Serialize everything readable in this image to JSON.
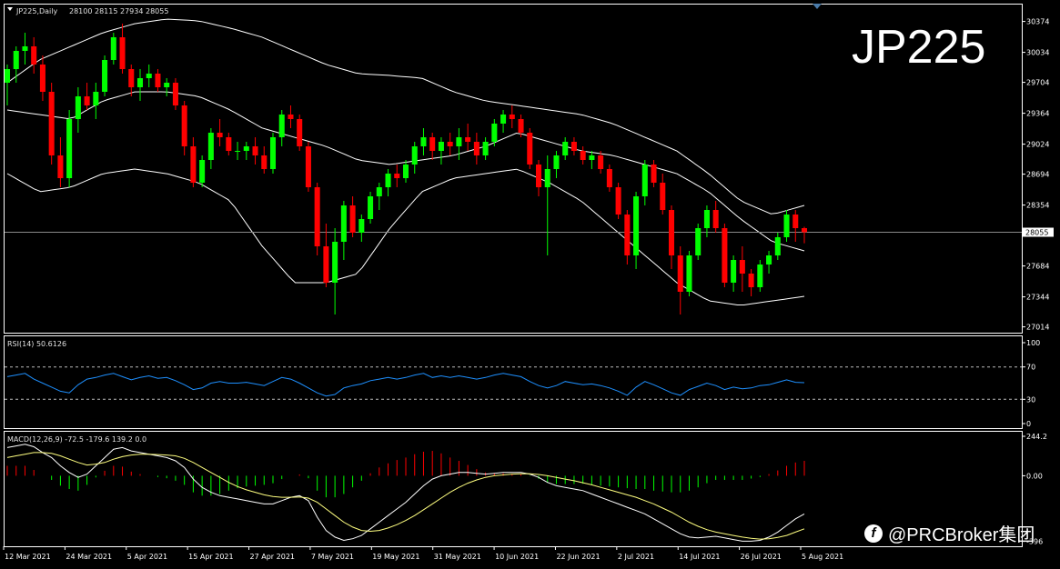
{
  "symbol_label": "JP225,Daily",
  "ohlc_label": "28100 28115 27934 28055",
  "watermark": "JP225",
  "brand": "@PRCBroker集团",
  "rsi_label": "RSI(14) 50.6126",
  "macd_label": "MACD(12,26,9) -72.5 -179.6 139.2 0.0",
  "colors": {
    "bull": "#00ff00",
    "bear": "#ff0000",
    "bands": "#ffffff",
    "rsi": "#1e90ff",
    "macd_signal": "#ffff80",
    "frame": "#ffffff",
    "price_line": "#8a8a8a"
  },
  "chart_data": [
    {
      "type": "candlestick",
      "title": "JP225,Daily",
      "y_ticks": [
        30374,
        30034,
        29704,
        29364,
        29024,
        28694,
        28354,
        28055,
        27684,
        27344,
        27014
      ],
      "ylim": [
        26950,
        30560
      ],
      "x_ticks": [
        "12 Mar 2021",
        "24 Mar 2021",
        "5 Apr 2021",
        "15 Apr 2021",
        "27 Apr 2021",
        "7 May 2021",
        "19 May 2021",
        "31 May 2021",
        "10 Jun 2021",
        "22 Jun 2021",
        "2 Jul 2021",
        "14 Jul 2021",
        "26 Jul 2021",
        "5 Aug 2021"
      ],
      "current_price": 28055,
      "bollinger": {
        "upper": [
          29700,
          29950,
          30100,
          30250,
          30350,
          30400,
          30380,
          30300,
          30200,
          30050,
          29900,
          29800,
          29780,
          29750,
          29600,
          29500,
          29450,
          29400,
          29350,
          29250,
          29100,
          28950,
          28700,
          28400,
          28250,
          28350
        ],
        "middle": [
          29400,
          29350,
          29300,
          29500,
          29600,
          29600,
          29550,
          29400,
          29200,
          29100,
          29000,
          28850,
          28800,
          28850,
          28900,
          29000,
          29150,
          29050,
          28950,
          28900,
          28800,
          28700,
          28500,
          28200,
          27950,
          27850
        ],
        "lower": [
          28700,
          28500,
          28550,
          28700,
          28750,
          28700,
          28600,
          28400,
          27900,
          27500,
          27500,
          27600,
          28100,
          28500,
          28650,
          28700,
          28750,
          28600,
          28400,
          28100,
          27800,
          27500,
          27300,
          27250,
          27300,
          27350
        ]
      },
      "series": [
        {
          "ohlc": [
            [
              29700,
              29900,
              29450,
              29850
            ],
            [
              29850,
              30100,
              29700,
              30050
            ],
            [
              30050,
              30250,
              29900,
              30100
            ],
            [
              30100,
              30200,
              29800,
              29900
            ],
            [
              29900,
              30000,
              29500,
              29600
            ],
            [
              29600,
              29700,
              28800,
              28900
            ],
            [
              28900,
              29100,
              28550,
              28650
            ],
            [
              28650,
              29400,
              28550,
              29300
            ],
            [
              29300,
              29650,
              29150,
              29550
            ],
            [
              29550,
              29700,
              29400,
              29450
            ],
            [
              29450,
              29700,
              29300,
              29600
            ],
            [
              29600,
              30000,
              29550,
              29950
            ],
            [
              29950,
              30250,
              29900,
              30200
            ],
            [
              30200,
              30350,
              29800,
              29850
            ],
            [
              29850,
              29900,
              29550,
              29650
            ],
            [
              29650,
              29850,
              29500,
              29750
            ],
            [
              29750,
              29900,
              29650,
              29800
            ],
            [
              29800,
              29850,
              29600,
              29650
            ],
            [
              29650,
              29750,
              29550,
              29700
            ],
            [
              29700,
              29750,
              29400,
              29450
            ],
            [
              29450,
              29500,
              28900,
              29000
            ],
            [
              29000,
              29100,
              28550,
              28600
            ],
            [
              28600,
              28900,
              28550,
              28850
            ],
            [
              28850,
              29200,
              28750,
              29150
            ],
            [
              29150,
              29300,
              29000,
              29100
            ],
            [
              29100,
              29150,
              28900,
              28950
            ],
            [
              28950,
              29050,
              28850,
              28950
            ],
            [
              28950,
              29050,
              28850,
              29000
            ],
            [
              29000,
              29100,
              28800,
              28900
            ],
            [
              28900,
              29000,
              28700,
              28750
            ],
            [
              28750,
              29150,
              28700,
              29100
            ],
            [
              29100,
              29400,
              29000,
              29350
            ],
            [
              29350,
              29450,
              29200,
              29300
            ],
            [
              29300,
              29350,
              28950,
              29000
            ],
            [
              29000,
              29050,
              28500,
              28550
            ],
            [
              28550,
              28600,
              27800,
              27900
            ],
            [
              27900,
              28150,
              27450,
              27500
            ],
            [
              27500,
              28100,
              27150,
              27950
            ],
            [
              27950,
              28400,
              27750,
              28350
            ],
            [
              28350,
              28450,
              28000,
              28050
            ],
            [
              28050,
              28250,
              27950,
              28200
            ],
            [
              28200,
              28500,
              28150,
              28450
            ],
            [
              28450,
              28600,
              28300,
              28550
            ],
            [
              28550,
              28750,
              28450,
              28700
            ],
            [
              28700,
              28800,
              28550,
              28650
            ],
            [
              28650,
              28850,
              28600,
              28800
            ],
            [
              28800,
              29050,
              28700,
              29000
            ],
            [
              29000,
              29200,
              28900,
              29100
            ],
            [
              29100,
              29150,
              28850,
              28950
            ],
            [
              28950,
              29100,
              28800,
              29050
            ],
            [
              29050,
              29150,
              28900,
              29000
            ],
            [
              29000,
              29200,
              28850,
              29100
            ],
            [
              29100,
              29250,
              28950,
              29050
            ],
            [
              29050,
              29150,
              28800,
              28900
            ],
            [
              28900,
              29100,
              28850,
              29050
            ],
            [
              29050,
              29300,
              29000,
              29250
            ],
            [
              29250,
              29400,
              29150,
              29350
            ],
            [
              29350,
              29450,
              29200,
              29300
            ],
            [
              29300,
              29350,
              29100,
              29150
            ],
            [
              29150,
              29200,
              28750,
              28800
            ],
            [
              28800,
              28850,
              28450,
              28550
            ],
            [
              28550,
              28900,
              27800,
              28750
            ],
            [
              28750,
              28950,
              28650,
              28900
            ],
            [
              28900,
              29100,
              28850,
              29050
            ],
            [
              29050,
              29100,
              28900,
              28950
            ],
            [
              28950,
              29000,
              28800,
              28850
            ],
            [
              28850,
              28950,
              28750,
              28900
            ],
            [
              28900,
              28950,
              28700,
              28750
            ],
            [
              28750,
              28800,
              28500,
              28550
            ],
            [
              28550,
              28600,
              28200,
              28250
            ],
            [
              28250,
              28300,
              27700,
              27800
            ],
            [
              27800,
              28500,
              27650,
              28450
            ],
            [
              28450,
              28850,
              28350,
              28800
            ],
            [
              28800,
              28850,
              28550,
              28600
            ],
            [
              28600,
              28700,
              28250,
              28300
            ],
            [
              28300,
              28350,
              27650,
              27800
            ],
            [
              27800,
              27900,
              27150,
              27400
            ],
            [
              27400,
              27850,
              27350,
              27800
            ],
            [
              27800,
              28150,
              27750,
              28100
            ],
            [
              28100,
              28350,
              28000,
              28300
            ],
            [
              28300,
              28400,
              28050,
              28100
            ],
            [
              28100,
              28150,
              27450,
              27500
            ],
            [
              27500,
              27800,
              27400,
              27750
            ],
            [
              27750,
              27900,
              27400,
              27600
            ],
            [
              27600,
              27650,
              27350,
              27450
            ],
            [
              27450,
              27750,
              27400,
              27700
            ],
            [
              27700,
              27850,
              27600,
              27800
            ],
            [
              27800,
              28050,
              27750,
              28000
            ],
            [
              28000,
              28300,
              27950,
              28250
            ],
            [
              28250,
              28300,
              27950,
              28100
            ],
            [
              28100,
              28115,
              27934,
              28055
            ]
          ]
        }
      ]
    },
    {
      "type": "line",
      "title": "RSI(14) 50.6126",
      "y_ticks": [
        100,
        70,
        30,
        0
      ],
      "ylim": [
        0,
        100
      ],
      "levels": [
        70,
        30
      ],
      "series": [
        {
          "values": [
            58,
            60,
            62,
            55,
            50,
            45,
            40,
            38,
            48,
            55,
            57,
            60,
            62,
            58,
            54,
            57,
            59,
            56,
            57,
            53,
            48,
            42,
            44,
            50,
            52,
            50,
            50,
            51,
            49,
            47,
            52,
            57,
            55,
            50,
            44,
            38,
            34,
            36,
            44,
            47,
            49,
            53,
            55,
            57,
            55,
            57,
            60,
            62,
            57,
            59,
            57,
            59,
            57,
            55,
            57,
            60,
            62,
            60,
            58,
            52,
            47,
            44,
            47,
            52,
            50,
            48,
            49,
            47,
            44,
            40,
            35,
            45,
            52,
            48,
            43,
            38,
            35,
            42,
            46,
            50,
            47,
            42,
            45,
            43,
            44,
            47,
            48,
            51,
            54,
            51,
            50.6
          ]
        }
      ]
    },
    {
      "type": "bar+line",
      "title": "MACD(12,26,9) -72.5 -179.6 139.2 0.0",
      "y_ticks": [
        244.2,
        0.0,
        -396
      ],
      "ylim": [
        -420,
        260
      ],
      "macd_line": [
        170,
        180,
        190,
        175,
        140,
        110,
        60,
        20,
        -10,
        10,
        60,
        110,
        160,
        170,
        150,
        140,
        130,
        120,
        110,
        90,
        50,
        -20,
        -70,
        -100,
        -120,
        -130,
        -140,
        -150,
        -160,
        -170,
        -170,
        -150,
        -130,
        -120,
        -150,
        -250,
        -330,
        -370,
        -390,
        -380,
        -360,
        -320,
        -280,
        -240,
        -200,
        -160,
        -110,
        -60,
        -20,
        0,
        10,
        20,
        20,
        15,
        10,
        15,
        20,
        20,
        20,
        10,
        -10,
        -40,
        -60,
        -70,
        -80,
        -90,
        -110,
        -130,
        -150,
        -170,
        -190,
        -210,
        -230,
        -260,
        -290,
        -320,
        -350,
        -370,
        -375,
        -370,
        -365,
        -375,
        -385,
        -395,
        -395,
        -390,
        -370,
        -340,
        -300,
        -260,
        -230
      ],
      "signal_line": [
        110,
        120,
        130,
        140,
        140,
        135,
        120,
        100,
        80,
        65,
        70,
        80,
        100,
        115,
        125,
        130,
        130,
        128,
        125,
        120,
        105,
        80,
        50,
        20,
        -10,
        -40,
        -65,
        -85,
        -100,
        -115,
        -125,
        -130,
        -130,
        -128,
        -135,
        -160,
        -200,
        -240,
        -280,
        -310,
        -330,
        -335,
        -330,
        -315,
        -295,
        -270,
        -240,
        -205,
        -170,
        -135,
        -100,
        -70,
        -45,
        -25,
        -10,
        0,
        5,
        10,
        12,
        12,
        8,
        0,
        -10,
        -20,
        -30,
        -42,
        -55,
        -70,
        -85,
        -100,
        -115,
        -130,
        -150,
        -170,
        -195,
        -220,
        -250,
        -280,
        -305,
        -325,
        -340,
        -350,
        -360,
        -370,
        -378,
        -382,
        -380,
        -372,
        -360,
        -340,
        -320
      ],
      "histogram": [
        60,
        60,
        60,
        35,
        0,
        -25,
        -60,
        -80,
        -90,
        -55,
        -10,
        30,
        60,
        55,
        25,
        10,
        0,
        -8,
        -15,
        -30,
        -55,
        -100,
        -120,
        -120,
        -110,
        -90,
        -75,
        -65,
        -60,
        -55,
        -45,
        -20,
        0,
        8,
        -15,
        -90,
        -130,
        -130,
        -110,
        -70,
        -30,
        15,
        50,
        75,
        95,
        110,
        130,
        145,
        150,
        135,
        110,
        90,
        65,
        40,
        20,
        15,
        15,
        10,
        8,
        -2,
        -18,
        -40,
        -50,
        -50,
        -50,
        -48,
        -55,
        -60,
        -65,
        -70,
        -75,
        -80,
        -80,
        -90,
        -95,
        -100,
        -100,
        -90,
        -70,
        -45,
        -25,
        -25,
        -25,
        -25,
        -17,
        -8,
        10,
        32,
        60,
        80,
        90
      ]
    }
  ]
}
